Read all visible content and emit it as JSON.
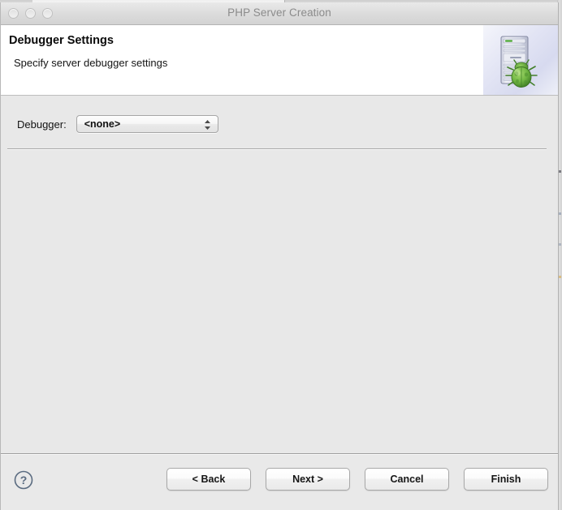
{
  "window": {
    "title": "PHP Server Creation",
    "traffic_lights": [
      "close-button",
      "minimize-button",
      "zoom-button"
    ]
  },
  "header": {
    "title": "Debugger Settings",
    "subtitle": "Specify server debugger settings",
    "icon": "server-with-bug-icon"
  },
  "content": {
    "debugger_field": {
      "label": "Debugger:",
      "selected": "<none>",
      "options": [
        "<none>"
      ]
    }
  },
  "footer": {
    "help": "?",
    "buttons": [
      {
        "name": "back-button",
        "label": "< Back",
        "enabled": true
      },
      {
        "name": "next-button",
        "label": "Next >",
        "enabled": true
      },
      {
        "name": "cancel-button",
        "label": "Cancel",
        "enabled": true
      },
      {
        "name": "finish-button",
        "label": "Finish",
        "enabled": true
      }
    ]
  },
  "colors": {
    "titlebar_text": "#8b8b8b",
    "content_bg": "#e8e8e8",
    "header_bg": "#ffffff",
    "icon_bug_green": "#6db33f",
    "icon_panel_bg": "#e2e4f4",
    "help_icon": "#5a6b80"
  }
}
